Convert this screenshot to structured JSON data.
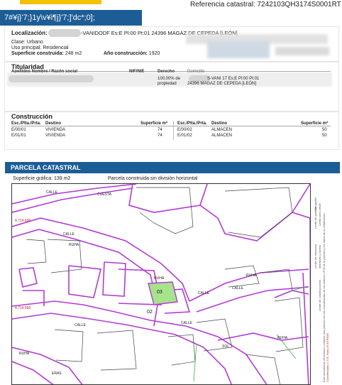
{
  "header": {
    "garbled_title": "7#¥j}'7;}1y\\v¥i¶j}'7;]'dc*;0];",
    "referencia_label": "Referencia catastral:",
    "referencia_value": "7242103QH3174S0001RT",
    "accent_yellow": "#f2c200",
    "accent_blue": "#1c5d96"
  },
  "inmueble": {
    "localizacion_label": "Localización:",
    "localizacion_value": "-VANIDODF   Es:E Pl:00 Pt:01 24396 MAGAZ DE CEPEDA [LEÓN]",
    "clase_label": "Clase:",
    "clase_value": "Urbano",
    "uso_label": "Uso principal:",
    "uso_value": "Residencial",
    "superficie_label": "Superficie construida:",
    "superficie_value": "248 m2",
    "anio_label": "Año construcción:",
    "anio_value": "1920"
  },
  "titularidad": {
    "title": "Titularidad",
    "col_nombre": "Apellidos Nombre / Razón social",
    "col_nif": "NIF/NIE",
    "col_derecho": "Derecho",
    "col_domicilio": "Domicilio",
    "derecho_value_1": "100,00% de",
    "derecho_value_2": "propiedad",
    "domicilio_line1": "S-VANI 17 Es:E Pl:00 Pt:01",
    "domicilio_line2": "24396 MAGAZ DE CEPEDA [LEÓN]"
  },
  "construccion": {
    "title": "Construcción",
    "headers": [
      "Esc./Plta./Prta.",
      "Destino",
      "Superficie m²"
    ],
    "left_rows": [
      [
        "E/00/01",
        "VIVIENDA",
        "74"
      ],
      [
        "E/01/01",
        "VIVIENDA",
        "74"
      ]
    ],
    "right_rows": [
      [
        "E/00/02",
        "ALMACEN",
        "50"
      ],
      [
        "E/01/02",
        "ALMACEN",
        "50"
      ]
    ]
  },
  "parcela": {
    "title": "PARCELA CATASTRAL",
    "superficie_label": "Superficie gráfica:",
    "superficie_value": "139 m2",
    "tipo": "Parcela construida sin división horizontal"
  },
  "map": {
    "street_labels": [
      "CALLE",
      "CUESTA",
      "CALLE",
      "RUHA",
      "RUHA",
      "CALLE",
      "CALLE",
      "RUHA",
      "CALLE",
      "SOL",
      "RUHA",
      "CALLE",
      "RUHA",
      "ERAS"
    ],
    "coords": [
      "4.714.600",
      "4.714.590"
    ],
    "parcel_numbers": [
      "03",
      "02"
    ],
    "legend": [
      "Límite de manzana",
      "Límite de parcela",
      "Límite de construcciones",
      "Mobiliario y aceras",
      "Hidrografía",
      "Límite zona verde"
    ],
    "footer_note": "Este documento electrónico contiene una prueba con las coordenadas de los vértices UTM de la parcela y los datos de la certificación",
    "utm_note": "Coordenadas U.T.M. Huso 29 ETRS89",
    "colors": {
      "parcel": "#b33ad6",
      "highlight": "#a6e38a",
      "building": "#444444"
    }
  }
}
